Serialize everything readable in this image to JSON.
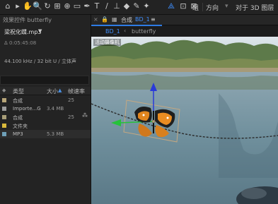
{
  "toolbar": {
    "tools": [
      {
        "icon": "home-icon",
        "glyph": "⌂"
      },
      {
        "icon": "arrow-tool-icon",
        "glyph": "▸"
      },
      {
        "icon": "hand-tool-icon",
        "glyph": "✋"
      },
      {
        "icon": "zoom-tool-icon",
        "glyph": "🔍"
      },
      {
        "icon": "rotate-tool-icon",
        "glyph": "↻"
      },
      {
        "icon": "camera-tool-icon",
        "glyph": "⊞"
      },
      {
        "icon": "pan-behind-tool-icon",
        "glyph": "⊕"
      },
      {
        "icon": "rectangle-tool-icon",
        "glyph": "▭"
      },
      {
        "icon": "pen-tool-icon",
        "glyph": "✒"
      },
      {
        "icon": "type-tool-icon",
        "glyph": "T"
      },
      {
        "icon": "brush-tool-icon",
        "glyph": "/"
      },
      {
        "icon": "clone-stamp-icon",
        "glyph": "⊥"
      },
      {
        "icon": "eraser-tool-icon",
        "glyph": "◆"
      },
      {
        "icon": "roto-brush-icon",
        "glyph": "✎"
      },
      {
        "icon": "puppet-pin-icon",
        "glyph": "✦"
      }
    ],
    "axis_icon": "axis-icon",
    "grid_label": "组",
    "direction_label": "方向",
    "align_label": "对于 3D 图层"
  },
  "left_panel": {
    "title": "效果控件 butterfly",
    "file_name": "梁祝化蝶.mp3",
    "duration": "Δ 0:05:45:08",
    "audio_info": "44.100 kHz / 32 bit U / 立体声",
    "columns": {
      "type": "类型",
      "size": "大小",
      "rate": "帧速率"
    },
    "rows": [
      {
        "color": "#b8a679",
        "name": "合成",
        "size": "",
        "rate": "25"
      },
      {
        "color": "#9c9c9c",
        "name": "Importe...G",
        "size": "3.4 MB",
        "rate": ""
      },
      {
        "color": "#a89e78",
        "name": "合成",
        "size": "",
        "rate": "25"
      },
      {
        "color": "#d9b93c",
        "name": "文件夹",
        "size": "",
        "rate": ""
      },
      {
        "color": "#6fa0b8",
        "name": "MP3",
        "size": "5.3 MB",
        "rate": ""
      }
    ]
  },
  "viewer": {
    "tab_label": "合成",
    "comp_name": "BD_1",
    "breadcrumb_comp": "BD_1",
    "breadcrumb_layer": "butterfly",
    "camera_label": "活动摄像机"
  }
}
